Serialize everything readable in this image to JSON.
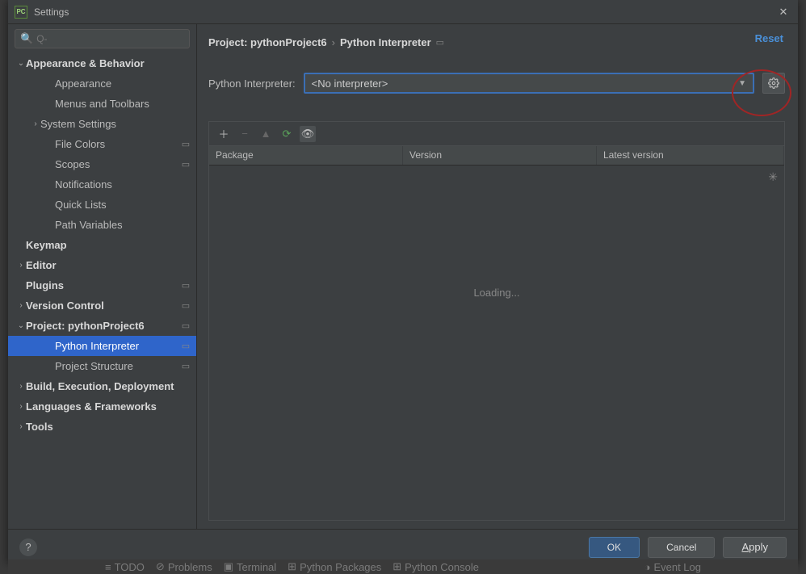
{
  "window": {
    "title": "Settings"
  },
  "search": {
    "placeholder": "Q-"
  },
  "tree": [
    {
      "label": "Appearance & Behavior",
      "depth": 0,
      "expanded": true,
      "bold": true
    },
    {
      "label": "Appearance",
      "depth": 2
    },
    {
      "label": "Menus and Toolbars",
      "depth": 2
    },
    {
      "label": "System Settings",
      "depth": 1,
      "expanded": false
    },
    {
      "label": "File Colors",
      "depth": 2,
      "glyph": "▭"
    },
    {
      "label": "Scopes",
      "depth": 2,
      "glyph": "▭"
    },
    {
      "label": "Notifications",
      "depth": 2
    },
    {
      "label": "Quick Lists",
      "depth": 2
    },
    {
      "label": "Path Variables",
      "depth": 2
    },
    {
      "label": "Keymap",
      "depth": 0,
      "bold": true
    },
    {
      "label": "Editor",
      "depth": 0,
      "expanded": false,
      "bold": true
    },
    {
      "label": "Plugins",
      "depth": 0,
      "bold": true,
      "glyph": "▭"
    },
    {
      "label": "Version Control",
      "depth": 0,
      "expanded": false,
      "bold": true,
      "glyph": "▭"
    },
    {
      "label": "Project: pythonProject6",
      "depth": 0,
      "expanded": true,
      "bold": true,
      "glyph": "▭"
    },
    {
      "label": "Python Interpreter",
      "depth": 2,
      "glyph": "▭",
      "selected": true
    },
    {
      "label": "Project Structure",
      "depth": 2,
      "glyph": "▭"
    },
    {
      "label": "Build, Execution, Deployment",
      "depth": 0,
      "expanded": false,
      "bold": true
    },
    {
      "label": "Languages & Frameworks",
      "depth": 0,
      "expanded": false,
      "bold": true
    },
    {
      "label": "Tools",
      "depth": 0,
      "expanded": false,
      "bold": true
    }
  ],
  "breadcrumb": {
    "a": "Project: pythonProject6",
    "b": "Python Interpreter",
    "tag": "▭"
  },
  "reset": "Reset",
  "interpreter": {
    "label": "Python Interpreter:",
    "value": "<No interpreter>"
  },
  "table": {
    "cols": [
      "Package",
      "Version",
      "Latest version"
    ],
    "loading": "Loading..."
  },
  "buttons": {
    "ok": "OK",
    "cancel": "Cancel",
    "apply": "Apply"
  },
  "statusbar": {
    "todo": "TODO",
    "problems": "Problems",
    "terminal": "Terminal",
    "pypkg": "Python Packages",
    "pycon": "Python Console",
    "eventlog": "Event Log"
  }
}
